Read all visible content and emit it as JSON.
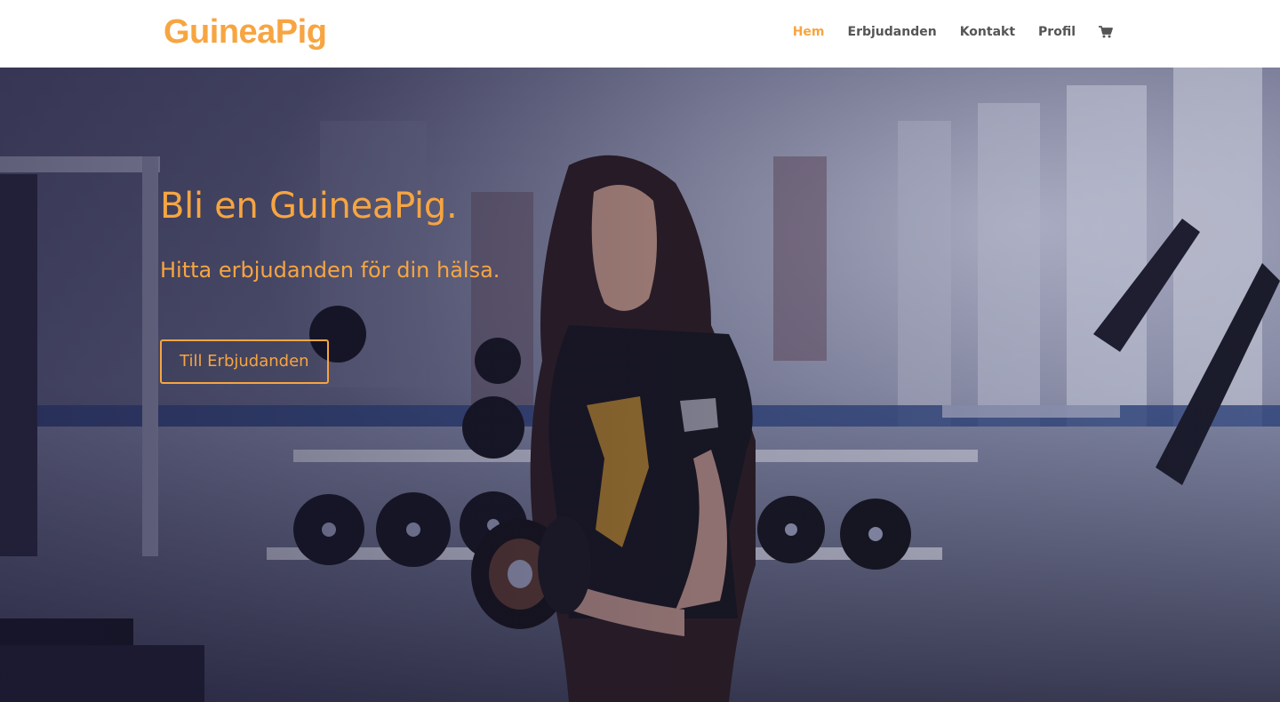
{
  "brand": {
    "name": "GuineaPig",
    "accent_color": "#f7a541"
  },
  "nav": {
    "items": [
      {
        "label": "Hem",
        "active": true
      },
      {
        "label": "Erbjudanden",
        "active": false
      },
      {
        "label": "Kontakt",
        "active": false
      },
      {
        "label": "Profil",
        "active": false
      }
    ],
    "cart_icon": "shopping-cart-icon"
  },
  "hero": {
    "title": "Bli en GuineaPig.",
    "subtitle": "Hitta erbjudanden för din hälsa.",
    "button_label": "Till Erbjudanden",
    "background": "gym-photo-woman-lifting-dumbbell"
  }
}
